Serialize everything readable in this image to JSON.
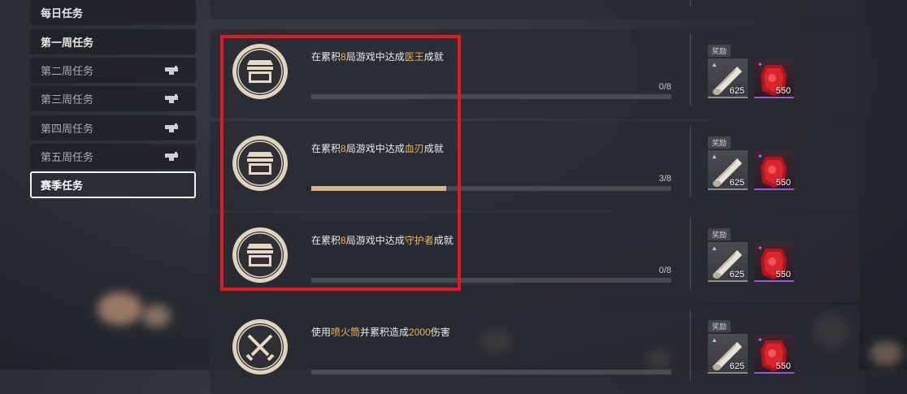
{
  "sidebar": {
    "items": [
      {
        "label": "每日任务",
        "locked": false,
        "active": false
      },
      {
        "label": "第一周任务",
        "locked": false,
        "active": false
      },
      {
        "label": "第二周任务",
        "locked": true,
        "active": false
      },
      {
        "label": "第三周任务",
        "locked": true,
        "active": false
      },
      {
        "label": "第四周任务",
        "locked": true,
        "active": false
      },
      {
        "label": "第五周任务",
        "locked": true,
        "active": false
      },
      {
        "label": "赛季任务",
        "locked": false,
        "active": true
      }
    ]
  },
  "tasks": [
    {
      "desc": {
        "pre": "",
        "hl1": "",
        "mid": "",
        "hl2": "",
        "post": ""
      },
      "progress": {
        "current": 0,
        "total": 8,
        "text": ""
      },
      "icon": "chest-icon"
    },
    {
      "desc": {
        "pre": "在累积",
        "hl1": "8",
        "mid": "局游戏中达成",
        "hl2": "医王",
        "post": "成就"
      },
      "progress": {
        "current": 0,
        "total": 8,
        "text": "0/8"
      },
      "icon": "chest-icon"
    },
    {
      "desc": {
        "pre": "在累积",
        "hl1": "8",
        "mid": "局游戏中达成",
        "hl2": "血刃",
        "post": "成就"
      },
      "progress": {
        "current": 3,
        "total": 8,
        "text": "3/8"
      },
      "icon": "chest-icon"
    },
    {
      "desc": {
        "pre": "在累积",
        "hl1": "8",
        "mid": "局游戏中达成",
        "hl2": "守护者",
        "post": "成就"
      },
      "progress": {
        "current": 0,
        "total": 8,
        "text": "0/8"
      },
      "icon": "chest-icon"
    },
    {
      "desc": {
        "pre": "使用",
        "hl1": "喷火筒",
        "mid": "并累积造成",
        "hl2": "2000",
        "post": "伤害"
      },
      "progress": {
        "current": 0,
        "total": 8,
        "text": ""
      },
      "icon": "crossed-swords-icon"
    }
  ],
  "reward": {
    "label": "奖励",
    "items": [
      {
        "name": "scroll",
        "qty": "625"
      },
      {
        "name": "red-gem",
        "qty": "550"
      }
    ]
  },
  "colors": {
    "highlight": "#e8b35c",
    "progress": "#e0b289",
    "annotation": "#e5191b"
  }
}
